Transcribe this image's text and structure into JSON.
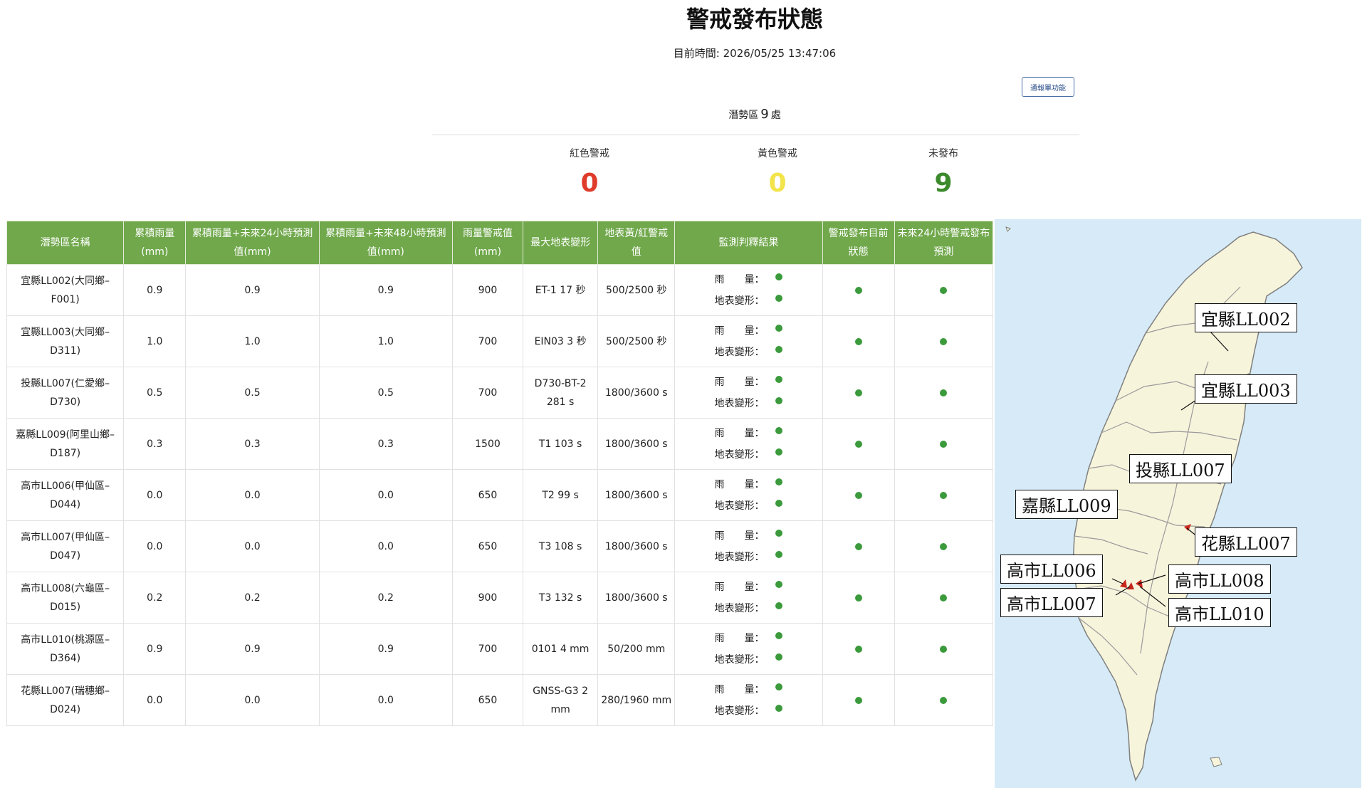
{
  "page": {
    "title": "警戒發布狀態",
    "time_label": "目前時間: ",
    "time_value": "2026/05/25 13:47:06",
    "notify_button": "通報單功能",
    "count_prefix": "潛勢區",
    "count_value": "9",
    "count_suffix": "處"
  },
  "stats": [
    {
      "label": "紅色警戒",
      "value": "0",
      "color": "#e03c2c"
    },
    {
      "label": "黃色警戒",
      "value": "0",
      "color": "#f2e44a"
    },
    {
      "label": "未發布",
      "value": "9",
      "color": "#3c8a2c"
    }
  ],
  "table": {
    "headers": [
      "潛勢區名稱",
      "累積雨量(mm)",
      "累積雨量+未來24小時預測值(mm)",
      "累積雨量+未來48小時預測值(mm)",
      "雨量警戒值(mm)",
      "最大地表變形",
      "地表黃/紅警戒值",
      "監測判釋結果",
      "警戒發布目前狀態",
      "未來24小時警戒發布預測"
    ],
    "monitor_rain_label": "雨　　量：",
    "monitor_ground_label": "地表變形：",
    "status_color": "#3b9a3b",
    "rows": [
      {
        "name": "宜縣LL002(大同鄉–F001)",
        "acc": "0.9",
        "p24": "0.9",
        "p48": "0.9",
        "rain_alert": "900",
        "max_def": "ET-1 17 秒",
        "def_alert": "500/2500 秒"
      },
      {
        "name": "宜縣LL003(大同鄉–D311)",
        "acc": "1.0",
        "p24": "1.0",
        "p48": "1.0",
        "rain_alert": "700",
        "max_def": "EIN03 3 秒",
        "def_alert": "500/2500 秒"
      },
      {
        "name": "投縣LL007(仁愛鄉–D730)",
        "acc": "0.5",
        "p24": "0.5",
        "p48": "0.5",
        "rain_alert": "700",
        "max_def": "D730-BT-2 281 s",
        "def_alert": "1800/3600 s"
      },
      {
        "name": "嘉縣LL009(阿里山鄉–D187)",
        "acc": "0.3",
        "p24": "0.3",
        "p48": "0.3",
        "rain_alert": "1500",
        "max_def": "T1 103 s",
        "def_alert": "1800/3600 s"
      },
      {
        "name": "高市LL006(甲仙區–D044)",
        "acc": "0.0",
        "p24": "0.0",
        "p48": "0.0",
        "rain_alert": "650",
        "max_def": "T2 99 s",
        "def_alert": "1800/3600 s"
      },
      {
        "name": "高市LL007(甲仙區–D047)",
        "acc": "0.0",
        "p24": "0.0",
        "p48": "0.0",
        "rain_alert": "650",
        "max_def": "T3 108 s",
        "def_alert": "1800/3600 s"
      },
      {
        "name": "高市LL008(六龜區–D015)",
        "acc": "0.2",
        "p24": "0.2",
        "p48": "0.2",
        "rain_alert": "900",
        "max_def": "T3 132 s",
        "def_alert": "1800/3600 s"
      },
      {
        "name": "高市LL010(桃源區–D364)",
        "acc": "0.9",
        "p24": "0.9",
        "p48": "0.9",
        "rain_alert": "700",
        "max_def": "0101 4 mm",
        "def_alert": "50/200 mm"
      },
      {
        "name": "花縣LL007(瑞穗鄉–D024)",
        "acc": "0.0",
        "p24": "0.0",
        "p48": "0.0",
        "rain_alert": "650",
        "max_def": "GNSS-G3 2 mm",
        "def_alert": "280/1960 mm"
      }
    ]
  },
  "map": {
    "sea_color": "#d6ebf7",
    "land_color": "#f7f4dc",
    "marker_color": "#c8261c",
    "labels": [
      "宜縣LL002",
      "宜縣LL003",
      "投縣LL007",
      "嘉縣LL009",
      "花縣LL007",
      "高市LL006",
      "高市LL007",
      "高市LL008",
      "高市LL010"
    ]
  }
}
